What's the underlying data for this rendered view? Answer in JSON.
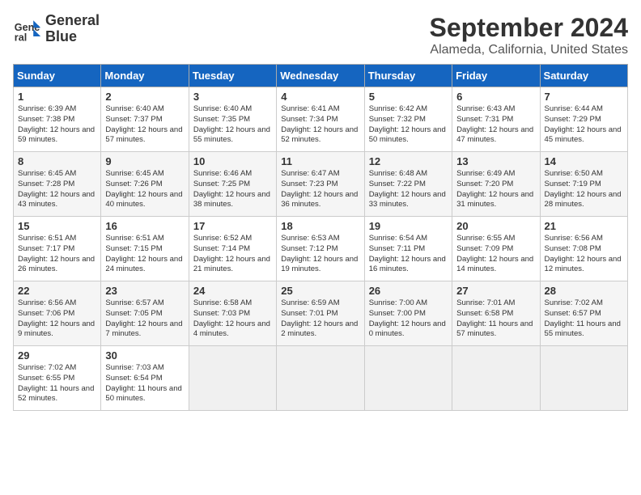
{
  "header": {
    "logo_line1": "General",
    "logo_line2": "Blue",
    "month": "September 2024",
    "location": "Alameda, California, United States"
  },
  "weekdays": [
    "Sunday",
    "Monday",
    "Tuesday",
    "Wednesday",
    "Thursday",
    "Friday",
    "Saturday"
  ],
  "weeks": [
    [
      {
        "day": "1",
        "sunrise": "Sunrise: 6:39 AM",
        "sunset": "Sunset: 7:38 PM",
        "daylight": "Daylight: 12 hours and 59 minutes."
      },
      {
        "day": "2",
        "sunrise": "Sunrise: 6:40 AM",
        "sunset": "Sunset: 7:37 PM",
        "daylight": "Daylight: 12 hours and 57 minutes."
      },
      {
        "day": "3",
        "sunrise": "Sunrise: 6:40 AM",
        "sunset": "Sunset: 7:35 PM",
        "daylight": "Daylight: 12 hours and 55 minutes."
      },
      {
        "day": "4",
        "sunrise": "Sunrise: 6:41 AM",
        "sunset": "Sunset: 7:34 PM",
        "daylight": "Daylight: 12 hours and 52 minutes."
      },
      {
        "day": "5",
        "sunrise": "Sunrise: 6:42 AM",
        "sunset": "Sunset: 7:32 PM",
        "daylight": "Daylight: 12 hours and 50 minutes."
      },
      {
        "day": "6",
        "sunrise": "Sunrise: 6:43 AM",
        "sunset": "Sunset: 7:31 PM",
        "daylight": "Daylight: 12 hours and 47 minutes."
      },
      {
        "day": "7",
        "sunrise": "Sunrise: 6:44 AM",
        "sunset": "Sunset: 7:29 PM",
        "daylight": "Daylight: 12 hours and 45 minutes."
      }
    ],
    [
      {
        "day": "8",
        "sunrise": "Sunrise: 6:45 AM",
        "sunset": "Sunset: 7:28 PM",
        "daylight": "Daylight: 12 hours and 43 minutes."
      },
      {
        "day": "9",
        "sunrise": "Sunrise: 6:45 AM",
        "sunset": "Sunset: 7:26 PM",
        "daylight": "Daylight: 12 hours and 40 minutes."
      },
      {
        "day": "10",
        "sunrise": "Sunrise: 6:46 AM",
        "sunset": "Sunset: 7:25 PM",
        "daylight": "Daylight: 12 hours and 38 minutes."
      },
      {
        "day": "11",
        "sunrise": "Sunrise: 6:47 AM",
        "sunset": "Sunset: 7:23 PM",
        "daylight": "Daylight: 12 hours and 36 minutes."
      },
      {
        "day": "12",
        "sunrise": "Sunrise: 6:48 AM",
        "sunset": "Sunset: 7:22 PM",
        "daylight": "Daylight: 12 hours and 33 minutes."
      },
      {
        "day": "13",
        "sunrise": "Sunrise: 6:49 AM",
        "sunset": "Sunset: 7:20 PM",
        "daylight": "Daylight: 12 hours and 31 minutes."
      },
      {
        "day": "14",
        "sunrise": "Sunrise: 6:50 AM",
        "sunset": "Sunset: 7:19 PM",
        "daylight": "Daylight: 12 hours and 28 minutes."
      }
    ],
    [
      {
        "day": "15",
        "sunrise": "Sunrise: 6:51 AM",
        "sunset": "Sunset: 7:17 PM",
        "daylight": "Daylight: 12 hours and 26 minutes."
      },
      {
        "day": "16",
        "sunrise": "Sunrise: 6:51 AM",
        "sunset": "Sunset: 7:15 PM",
        "daylight": "Daylight: 12 hours and 24 minutes."
      },
      {
        "day": "17",
        "sunrise": "Sunrise: 6:52 AM",
        "sunset": "Sunset: 7:14 PM",
        "daylight": "Daylight: 12 hours and 21 minutes."
      },
      {
        "day": "18",
        "sunrise": "Sunrise: 6:53 AM",
        "sunset": "Sunset: 7:12 PM",
        "daylight": "Daylight: 12 hours and 19 minutes."
      },
      {
        "day": "19",
        "sunrise": "Sunrise: 6:54 AM",
        "sunset": "Sunset: 7:11 PM",
        "daylight": "Daylight: 12 hours and 16 minutes."
      },
      {
        "day": "20",
        "sunrise": "Sunrise: 6:55 AM",
        "sunset": "Sunset: 7:09 PM",
        "daylight": "Daylight: 12 hours and 14 minutes."
      },
      {
        "day": "21",
        "sunrise": "Sunrise: 6:56 AM",
        "sunset": "Sunset: 7:08 PM",
        "daylight": "Daylight: 12 hours and 12 minutes."
      }
    ],
    [
      {
        "day": "22",
        "sunrise": "Sunrise: 6:56 AM",
        "sunset": "Sunset: 7:06 PM",
        "daylight": "Daylight: 12 hours and 9 minutes."
      },
      {
        "day": "23",
        "sunrise": "Sunrise: 6:57 AM",
        "sunset": "Sunset: 7:05 PM",
        "daylight": "Daylight: 12 hours and 7 minutes."
      },
      {
        "day": "24",
        "sunrise": "Sunrise: 6:58 AM",
        "sunset": "Sunset: 7:03 PM",
        "daylight": "Daylight: 12 hours and 4 minutes."
      },
      {
        "day": "25",
        "sunrise": "Sunrise: 6:59 AM",
        "sunset": "Sunset: 7:01 PM",
        "daylight": "Daylight: 12 hours and 2 minutes."
      },
      {
        "day": "26",
        "sunrise": "Sunrise: 7:00 AM",
        "sunset": "Sunset: 7:00 PM",
        "daylight": "Daylight: 12 hours and 0 minutes."
      },
      {
        "day": "27",
        "sunrise": "Sunrise: 7:01 AM",
        "sunset": "Sunset: 6:58 PM",
        "daylight": "Daylight: 11 hours and 57 minutes."
      },
      {
        "day": "28",
        "sunrise": "Sunrise: 7:02 AM",
        "sunset": "Sunset: 6:57 PM",
        "daylight": "Daylight: 11 hours and 55 minutes."
      }
    ],
    [
      {
        "day": "29",
        "sunrise": "Sunrise: 7:02 AM",
        "sunset": "Sunset: 6:55 PM",
        "daylight": "Daylight: 11 hours and 52 minutes."
      },
      {
        "day": "30",
        "sunrise": "Sunrise: 7:03 AM",
        "sunset": "Sunset: 6:54 PM",
        "daylight": "Daylight: 11 hours and 50 minutes."
      },
      null,
      null,
      null,
      null,
      null
    ]
  ]
}
